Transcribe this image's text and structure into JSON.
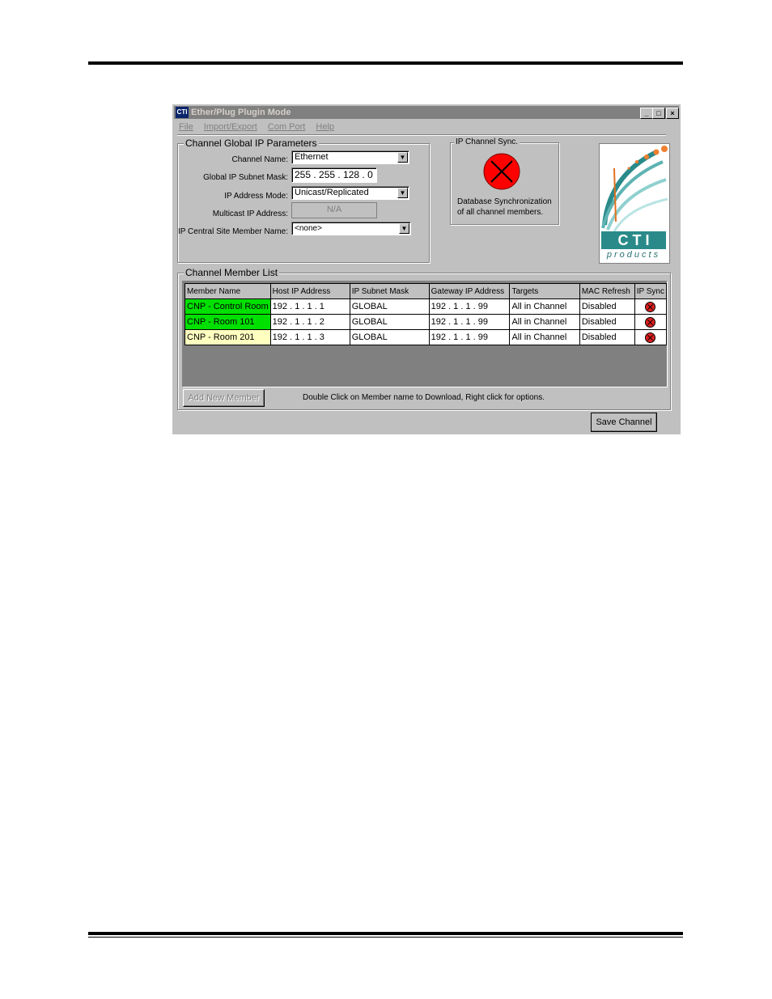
{
  "window": {
    "title": "Ether/Plug Plugin Mode",
    "icon_text": "CTI",
    "controls": {
      "minimize": "_",
      "maximize": "□",
      "close": "×"
    }
  },
  "menu": [
    "File",
    "Import/Export",
    "Com Port",
    "Help"
  ],
  "global_params": {
    "legend": "Channel Global IP Parameters",
    "channel_name_label": "Channel Name:",
    "channel_name_value": "Ethernet",
    "subnet_mask_label": "Global IP Subnet Mask:",
    "subnet_mask_value": "255 . 255 . 128 .  0",
    "address_mode_label": "IP Address Mode:",
    "address_mode_value": "Unicast/Replicated",
    "multicast_label": "Multicast IP Address:",
    "multicast_value": "N/A",
    "central_site_label": "IP Central Site Member Name:",
    "central_site_value": "<none>"
  },
  "sync": {
    "legend": "IP Channel Sync.",
    "line1": "Database Synchronization",
    "line2": "of all channel members.",
    "status_color": "#ff0000"
  },
  "logo": {
    "brand": "C T I",
    "sub": "products"
  },
  "member_list": {
    "legend": "Channel Member List",
    "columns": [
      "Member Name",
      "Host IP Address",
      "IP Subnet Mask",
      "Gateway IP Address",
      "Targets",
      "MAC Refresh",
      "IP Sync"
    ],
    "rows": [
      {
        "name": "CNP - Control Room",
        "host": "192 . 1 . 1 . 1",
        "mask": "GLOBAL",
        "gateway": "192 . 1 . 1 . 99",
        "targets": "All in Channel",
        "mac": "Disabled",
        "name_bg": "#00e000"
      },
      {
        "name": "CNP - Room 101",
        "host": "192 . 1 . 1 . 2",
        "mask": "GLOBAL",
        "gateway": "192 . 1 . 1 . 99",
        "targets": "All in Channel",
        "mac": "Disabled",
        "name_bg": "#00e000"
      },
      {
        "name": "CNP - Room 201",
        "host": "192 . 1 . 1 . 3",
        "mask": "GLOBAL",
        "gateway": "192 . 1 . 1 . 99",
        "targets": "All in Channel",
        "mac": "Disabled",
        "name_bg": "#ffffc0"
      }
    ],
    "add_button": "Add New Member",
    "hint": "Double Click on Member name to Download,  Right click for options."
  },
  "save_button": "Save Channel"
}
